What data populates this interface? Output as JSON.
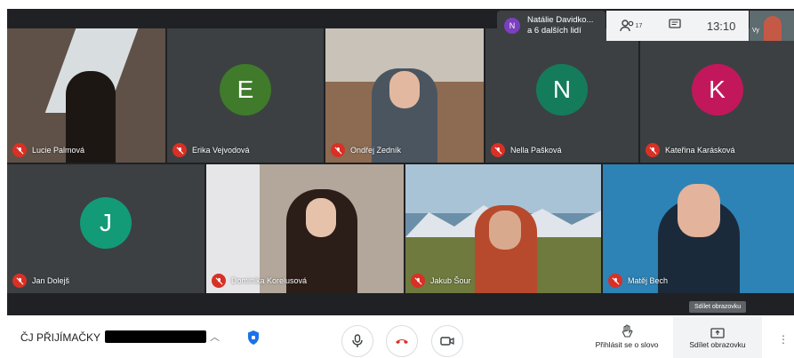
{
  "participants_row1": [
    {
      "name": "Lucie Palmová",
      "avatar": "",
      "bg": "#5f5147"
    },
    {
      "name": "Erika Vejvodová",
      "avatar": "E",
      "bg": "#3c4043",
      "avatar_color": "#3f7b2a"
    },
    {
      "name": "Ondřej Zedník",
      "avatar": "",
      "bg": "#8c6b52"
    },
    {
      "name": "Nella Pašková",
      "avatar": "N",
      "bg": "#3c4043",
      "avatar_color": "#147c5a"
    },
    {
      "name": "Kateřina Karásková",
      "avatar": "K",
      "bg": "#3c4043",
      "avatar_color": "#c2185b"
    }
  ],
  "participants_row2": [
    {
      "name": "Jan Dolejš",
      "avatar": "J",
      "bg": "#3c4043",
      "avatar_color": "#139b78"
    },
    {
      "name": "Dominika Korelusová",
      "avatar": "",
      "bg": "#b2a79a"
    },
    {
      "name": "Jakub Šour",
      "avatar": "",
      "bg": "#6b8fa8"
    },
    {
      "name": "Matěj Bech",
      "avatar": "",
      "bg": "#2d83b5"
    }
  ],
  "people_overlay": {
    "initial": "N",
    "line1": "Natálie Davidko...",
    "line2": "a 6 dalších lidí"
  },
  "topbar": {
    "participants_count": "17",
    "time": "13:10",
    "self_label": "Vy"
  },
  "bottombar": {
    "meeting_name": "ČJ PŘIJÍMAČKY",
    "raise_hand_label": "Přihlásit se o slovo",
    "present_label": "Sdílet obrazovku",
    "tooltip": "Sdílet obrazovku"
  },
  "colors": {
    "mic_off": "#d93025",
    "end_call": "#d93025",
    "stage": "#202124"
  }
}
